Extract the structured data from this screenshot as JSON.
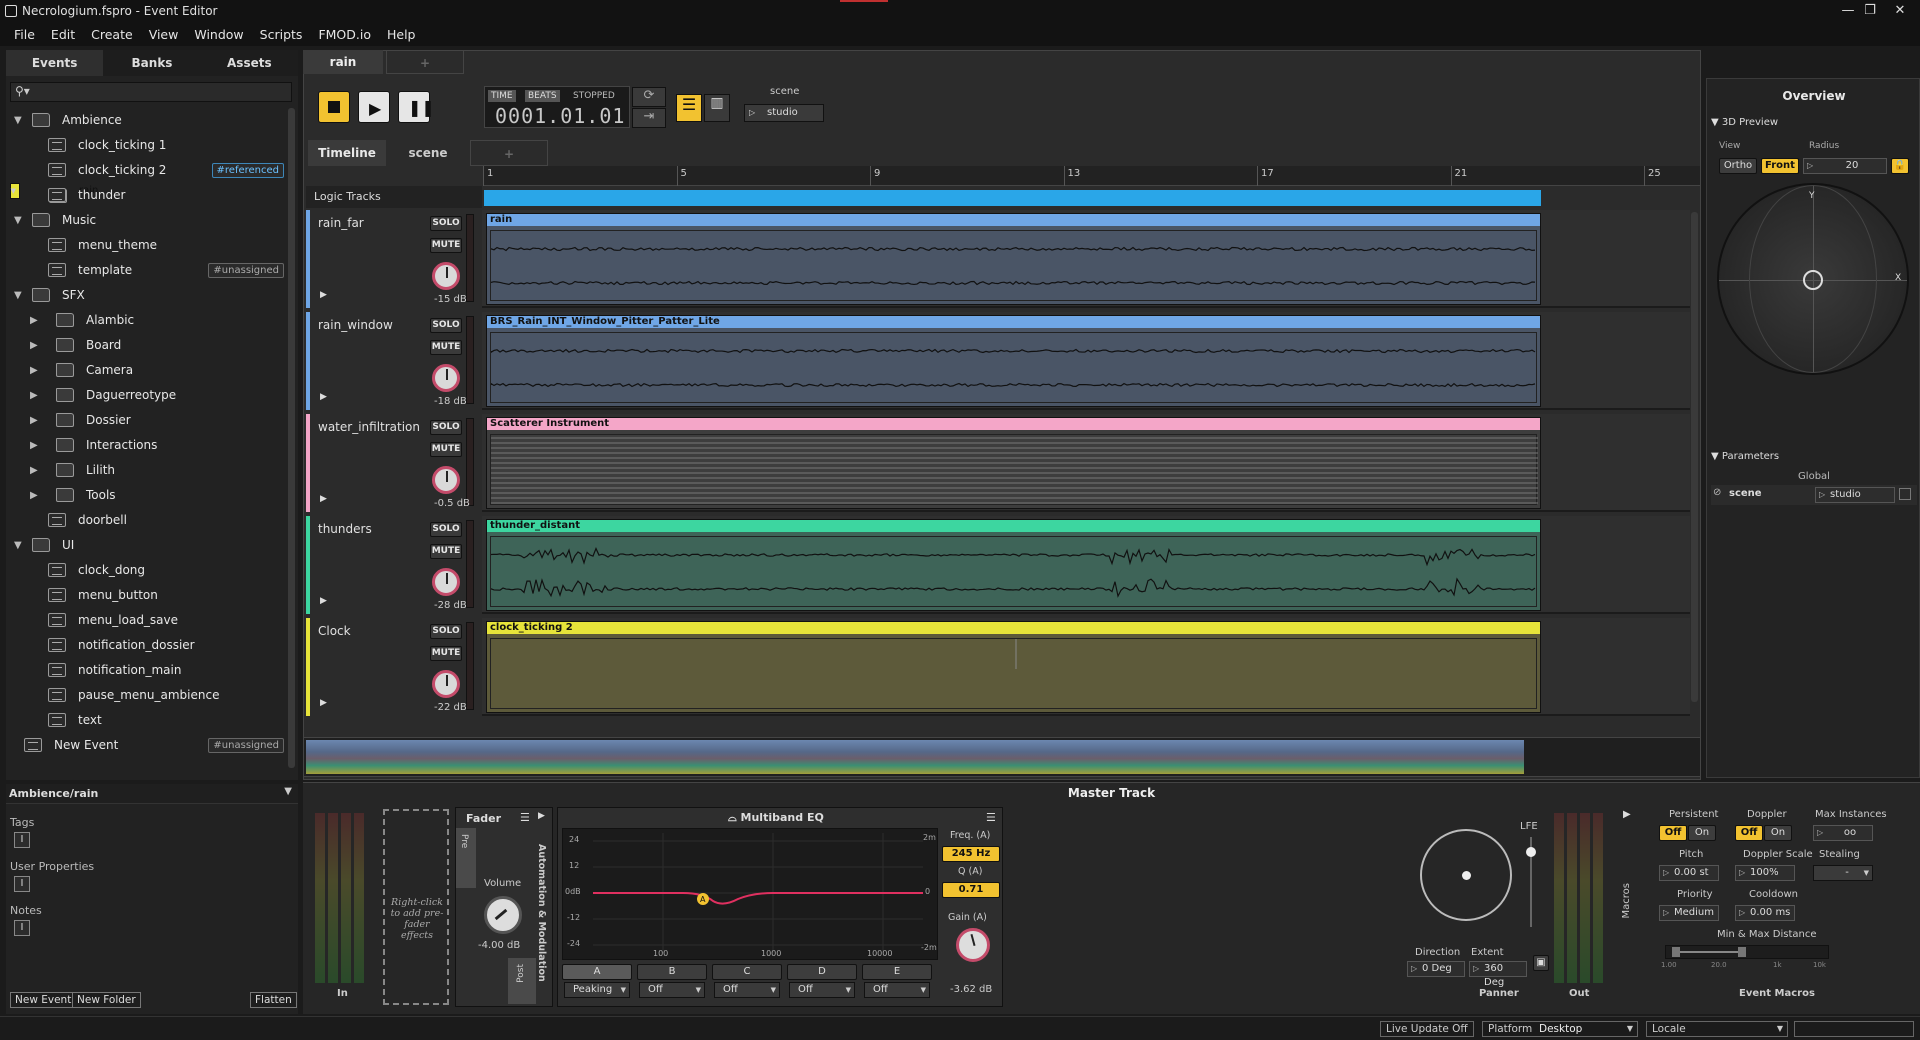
{
  "window": {
    "title": "Necrologium.fspro - Event Editor"
  },
  "menu": [
    "File",
    "Edit",
    "Create",
    "View",
    "Window",
    "Scripts",
    "FMOD.io",
    "Help"
  ],
  "browser": {
    "tabs": [
      "Events",
      "Banks",
      "Assets"
    ],
    "tree": [
      {
        "label": "Ambience",
        "kind": "folder",
        "depth": 0,
        "expanded": true
      },
      {
        "label": "clock_ticking 1",
        "kind": "event",
        "depth": 1
      },
      {
        "label": "clock_ticking 2",
        "kind": "event",
        "depth": 1,
        "tag": "#referenced"
      },
      {
        "label": "rain",
        "kind": "event",
        "depth": 1,
        "selected": true
      },
      {
        "label": "thunder",
        "kind": "event",
        "depth": 1
      },
      {
        "label": "Music",
        "kind": "folder",
        "depth": 0,
        "expanded": true
      },
      {
        "label": "menu_theme",
        "kind": "event",
        "depth": 1
      },
      {
        "label": "template",
        "kind": "event",
        "depth": 1,
        "tag": "#unassigned"
      },
      {
        "label": "SFX",
        "kind": "folder",
        "depth": 0,
        "expanded": true
      },
      {
        "label": "Alambic",
        "kind": "folder",
        "depth": 1
      },
      {
        "label": "Board",
        "kind": "folder",
        "depth": 1
      },
      {
        "label": "Camera",
        "kind": "folder",
        "depth": 1
      },
      {
        "label": "Daguerreotype",
        "kind": "folder",
        "depth": 1
      },
      {
        "label": "Dossier",
        "kind": "folder",
        "depth": 1
      },
      {
        "label": "Interactions",
        "kind": "folder",
        "depth": 1
      },
      {
        "label": "Lilith",
        "kind": "folder",
        "depth": 1
      },
      {
        "label": "Tools",
        "kind": "folder",
        "depth": 1
      },
      {
        "label": "doorbell",
        "kind": "event",
        "depth": 1
      },
      {
        "label": "UI",
        "kind": "folder",
        "depth": 0,
        "expanded": true
      },
      {
        "label": "clock_dong",
        "kind": "event",
        "depth": 1
      },
      {
        "label": "menu_button",
        "kind": "event",
        "depth": 1
      },
      {
        "label": "menu_load_save",
        "kind": "event",
        "depth": 1
      },
      {
        "label": "notification_dossier",
        "kind": "event",
        "depth": 1
      },
      {
        "label": "notification_main",
        "kind": "event",
        "depth": 1
      },
      {
        "label": "pause_menu_ambience",
        "kind": "event",
        "depth": 1
      },
      {
        "label": "text",
        "kind": "event",
        "depth": 1
      },
      {
        "label": "New Event",
        "kind": "event",
        "depth": 0,
        "tag": "#unassigned"
      }
    ],
    "path": "Ambience/rain",
    "tags_label": "Tags",
    "user_props_label": "User Properties",
    "notes_label": "Notes",
    "buttons": {
      "new_event": "New Event",
      "new_folder": "New Folder",
      "flatten": "Flatten"
    }
  },
  "editor": {
    "event_tab": "rain",
    "transport": {
      "time": "TIME",
      "beats": "BEATS",
      "state": "STOPPED",
      "position": "0001.01.01"
    },
    "param_label": "scene",
    "param_value": "studio",
    "subtabs": [
      "Timeline",
      "scene"
    ],
    "logic_tracks": "Logic Tracks",
    "ruler": [
      "1",
      "5",
      "9",
      "13",
      "17",
      "21",
      "25"
    ],
    "tracks": [
      {
        "name": "rain_far",
        "db": "-15 dB",
        "region": "rain",
        "color": "#6fa6e6",
        "body": "#4a5566"
      },
      {
        "name": "rain_window",
        "db": "-18 dB",
        "region": "BRS_Rain_INT_Window_Pitter_Patter_Lite",
        "color": "#6fa6e6",
        "body": "#4a5566"
      },
      {
        "name": "water_infiltration",
        "db": "-0.5 dB",
        "region": "Scatterer Instrument",
        "color": "#f4a6c8",
        "body": "#3d3d3d"
      },
      {
        "name": "thunders",
        "db": "-28 dB",
        "region": "thunder_distant",
        "color": "#3dd6a0",
        "body": "#3e6458"
      },
      {
        "name": "Clock",
        "db": "-22 dB",
        "region": "clock_ticking 2",
        "color": "#e7e43a",
        "body": "#5d5a3a"
      }
    ],
    "solo": "SOLO",
    "mute": "MUTE"
  },
  "overview": {
    "title": "Overview",
    "preview": "3D Preview",
    "view_label": "View",
    "radius_label": "Radius",
    "ortho": "Ortho",
    "front": "Front",
    "radius": "20",
    "axis_y": "Y",
    "axis_x": "X",
    "parameters": "Parameters",
    "global": "Global",
    "param": "scene",
    "param_val": "studio"
  },
  "master": {
    "title": "Master Track",
    "in": "In",
    "out": "Out",
    "prefader": "Right-click to add pre-fader effects",
    "fader": "Fader",
    "pre": "Pre",
    "post": "Post",
    "volume": "Volume",
    "volume_db": "-4.00 dB",
    "automation": "Automation & Modulation",
    "eq_title": "Multiband EQ",
    "eq_db_labels": [
      "24",
      "12",
      "0dB",
      "-12",
      "-24"
    ],
    "eq_freq_labels": [
      "100",
      "1000",
      "10000"
    ],
    "eq_right_labels": [
      "2m",
      "0",
      "-2m"
    ],
    "bands": [
      {
        "name": "A",
        "mode": "Peaking"
      },
      {
        "name": "B",
        "mode": "Off"
      },
      {
        "name": "C",
        "mode": "Off"
      },
      {
        "name": "D",
        "mode": "Off"
      },
      {
        "name": "E",
        "mode": "Off"
      }
    ],
    "freq_label": "Freq. (A)",
    "freq": "245 Hz",
    "q_label": "Q (A)",
    "q": "0.71",
    "gain_label": "Gain (A)",
    "gain": "-3.62 dB",
    "panner": "Panner",
    "direction_label": "Direction",
    "direction": "0 Deg",
    "extent_label": "Extent",
    "extent": "360 Deg",
    "lfe": "LFE",
    "macros": "Macros",
    "persistent": "Persistent",
    "doppler": "Doppler",
    "max_instances": "Max Instances",
    "off": "Off",
    "on": "On",
    "max_val": "oo",
    "pitch": "Pitch",
    "pitch_val": "0.00 st",
    "doppler_scale": "Doppler Scale",
    "doppler_val": "100%",
    "stealing": "Stealing",
    "stealing_val": "-",
    "priority": "Priority",
    "priority_val": "Medium",
    "cooldown": "Cooldown",
    "cooldown_val": "0.00 ms",
    "minmax": "Min & Max Distance",
    "dist_ticks": [
      "1.00",
      "20.0",
      "1k",
      "10k"
    ],
    "event_macros": "Event Macros"
  },
  "status": {
    "live_update": "Live Update Off",
    "platform_label": "Platform",
    "platform": "Desktop",
    "locale": "Locale"
  },
  "colors": {
    "accent": "#f2c230",
    "selected": "#e7e43a",
    "timeline": "#2aa6e8",
    "knob": "#c44b6a"
  }
}
